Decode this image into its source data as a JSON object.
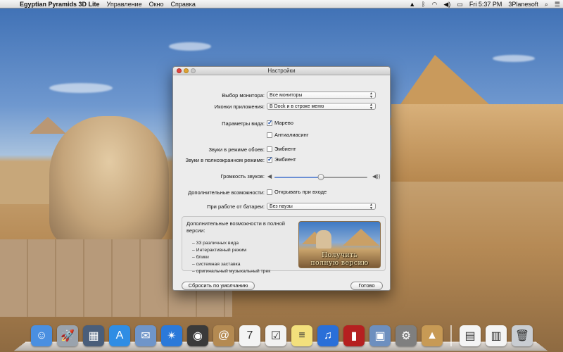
{
  "menubar": {
    "app_name": "Egyptian Pyramids 3D Lite",
    "menus": [
      "Управление",
      "Окно",
      "Справка"
    ],
    "clock": "Fri 5:37 PM",
    "user": "3Planesoft"
  },
  "window": {
    "title": "Настройки",
    "monitor": {
      "label": "Выбор монитора:",
      "value": "Все мониторы"
    },
    "app_icons": {
      "label": "Иконки приложения:",
      "value": "В Dock и в строке меню"
    },
    "view_params": {
      "label": "Параметры вида:",
      "opt1": "Марево",
      "opt1_checked": true,
      "opt2": "Антиалиасинг",
      "opt2_checked": false
    },
    "wallpaper_sounds": {
      "label": "Звуки в режиме обоев:",
      "opt": "Эмбиент",
      "checked": false
    },
    "fullscreen_sounds": {
      "label": "Звуки в полноэкранном режиме:",
      "opt": "Эмбиент",
      "checked": true
    },
    "volume": {
      "label": "Громкость звуков:",
      "level": 0.5
    },
    "extra": {
      "label": "Дополнительные возможности:",
      "opt": "Открывать при входе",
      "checked": false
    },
    "battery": {
      "label": "При работе от батареи:",
      "value": "Без паузы"
    },
    "promo": {
      "title": "Дополнительные возможности в полной версии:",
      "features": [
        "33 различных вида",
        "Интерактивный режим",
        "блики",
        "системная заставка",
        "оригинальный музыкальный трек"
      ],
      "cta_line1": "Получить",
      "cta_line2": "полную версию"
    },
    "reset_button": "Сбросить по умолчанию",
    "done_button": "Готово"
  },
  "dock": {
    "items": [
      {
        "name": "finder-icon",
        "color": "#4a8fe0",
        "glyph": "☺"
      },
      {
        "name": "launchpad-icon",
        "color": "#9aa3ad",
        "glyph": "🚀"
      },
      {
        "name": "mission-control-icon",
        "color": "#4a5e7a",
        "glyph": "▦"
      },
      {
        "name": "app-store-icon",
        "color": "#2f8de4",
        "glyph": "A"
      },
      {
        "name": "mail-icon",
        "color": "#6f95c9",
        "glyph": "✉"
      },
      {
        "name": "safari-icon",
        "color": "#2b79d9",
        "glyph": "✴"
      },
      {
        "name": "facetime-icon",
        "color": "#3a3a3a",
        "glyph": "◉"
      },
      {
        "name": "address-book-icon",
        "color": "#b48a52",
        "glyph": "@"
      },
      {
        "name": "calendar-icon",
        "color": "#f4f4f4",
        "glyph": "7"
      },
      {
        "name": "reminders-icon",
        "color": "#f2f2f2",
        "glyph": "☑"
      },
      {
        "name": "notes-icon",
        "color": "#f3e07c",
        "glyph": "≡"
      },
      {
        "name": "itunes-icon",
        "color": "#2a6fd8",
        "glyph": "♫"
      },
      {
        "name": "photo-booth-icon",
        "color": "#b52020",
        "glyph": "▮"
      },
      {
        "name": "iphoto-icon",
        "color": "#6d8fbf",
        "glyph": "▣"
      },
      {
        "name": "system-preferences-icon",
        "color": "#7f7f7f",
        "glyph": "⚙"
      },
      {
        "name": "egyptian-pyramids-icon",
        "color": "#c79a55",
        "glyph": "▲"
      },
      {
        "name": "documents-stack-icon",
        "color": "#f4f4f4",
        "glyph": "▤"
      },
      {
        "name": "downloads-stack-icon",
        "color": "#f4f4f4",
        "glyph": "▥"
      },
      {
        "name": "trash-icon",
        "color": "#c9cdd2",
        "glyph": "🗑"
      }
    ]
  }
}
